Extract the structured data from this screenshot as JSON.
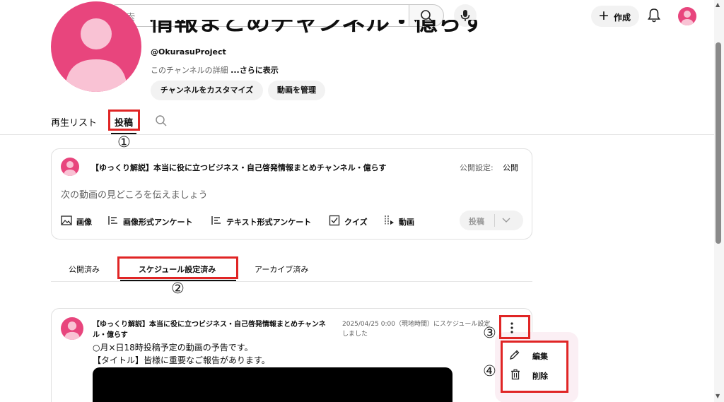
{
  "search": {
    "placeholder": "検索"
  },
  "header": {
    "create_label": "作成"
  },
  "channel": {
    "title": "情報まとめチャンネル・億らす",
    "handle": "@OkurasuProject",
    "description": "このチャンネルの詳細",
    "more_link": "...さらに表示",
    "customize_button": "チャンネルをカスタマイズ",
    "manage_button": "動画を管理"
  },
  "tabs": {
    "playlists": "再生リスト",
    "posts": "投稿"
  },
  "annotations": {
    "one": "①",
    "two": "②",
    "three": "③",
    "four": "④"
  },
  "composer": {
    "channel_name": "【ゆっくり解説】本当に役に立つビジネス・自己啓発情報まとめチャンネル・億らす",
    "visibility_label": "公開設定:",
    "visibility_value": "公開",
    "placeholder": "次の動画の見どころを伝えましょう",
    "tools": [
      "画像",
      "画像形式アンケート",
      "テキスト形式アンケート",
      "クイズ",
      "動画"
    ],
    "post_button": "投稿"
  },
  "subtabs": {
    "published": "公開済み",
    "scheduled": "スケジュール設定済み",
    "archived": "アーカイブ済み"
  },
  "post": {
    "channel_line1": "【ゆっくり解説】本当に役に立つビジネス・自己啓発情報まとめチャンネ",
    "channel_line2": "ル・億らす",
    "schedule_line1": "2025/04/25 0:00（現地時間）にスケジュール設定",
    "schedule_line2": "しました",
    "body_line1": "○月×日18時投稿予定の動画の予告です。",
    "body_line2": "【タイトル】皆様に重要なご報告があります。"
  },
  "menu": {
    "edit": "編集",
    "delete": "削除"
  },
  "colors": {
    "accent_red": "#e02525",
    "avatar_pink": "#e8457d"
  }
}
